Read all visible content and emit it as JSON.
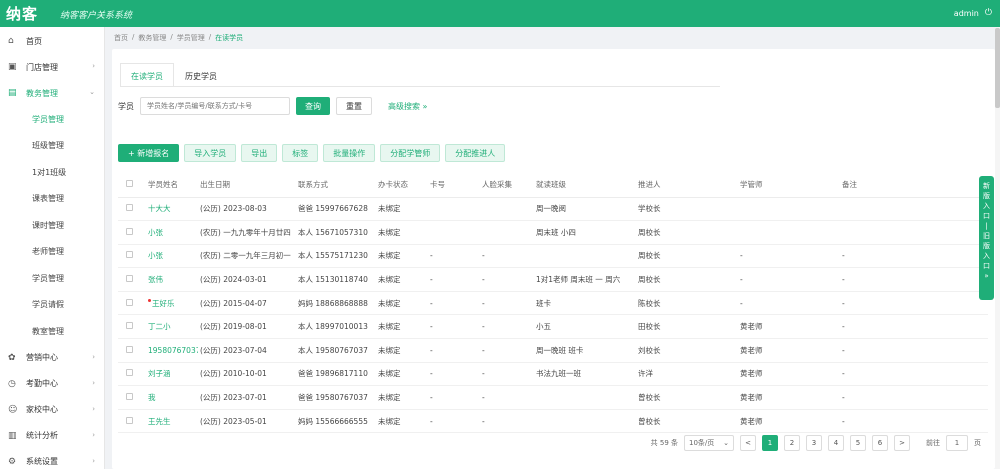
{
  "brand": {
    "logo": "纳客",
    "subtitle": "纳客客户关系系统"
  },
  "topbar": {
    "user": "admin"
  },
  "sidebar": {
    "items": [
      {
        "label": "首页",
        "icon": "home-icon"
      },
      {
        "label": "门店管理",
        "icon": "store-icon"
      },
      {
        "label": "教务管理",
        "icon": "book-icon",
        "active": true
      }
    ],
    "subitems": [
      {
        "label": "学员管理",
        "active": true
      },
      {
        "label": "班级管理"
      },
      {
        "label": "1对1班级"
      },
      {
        "label": "课表管理"
      },
      {
        "label": "课时管理"
      },
      {
        "label": "老师管理"
      },
      {
        "label": "学员管理"
      },
      {
        "label": "学员请假"
      },
      {
        "label": "教室管理"
      }
    ],
    "bottom_items": [
      {
        "label": "营销中心",
        "icon": "gift-icon"
      },
      {
        "label": "考勤中心",
        "icon": "clock-icon"
      },
      {
        "label": "家校中心",
        "icon": "people-icon"
      },
      {
        "label": "统计分析",
        "icon": "chart-icon"
      },
      {
        "label": "系统设置",
        "icon": "gear-icon"
      }
    ]
  },
  "breadcrumb": [
    "首页",
    "教务管理",
    "学员管理",
    "在读学员"
  ],
  "tabs": [
    "在读学员",
    "历史学员"
  ],
  "search": {
    "label": "学员",
    "placeholder": "学员姓名/学员编号/联系方式/卡号",
    "search_btn": "查询",
    "reset_btn": "重置",
    "advanced": "高级搜索 »"
  },
  "actions": {
    "primary": "+ 新增报名",
    "buttons": [
      "导入学员",
      "导出",
      "标签",
      "批量操作",
      "分配学管师",
      "分配推进人"
    ]
  },
  "table": {
    "headers": [
      "学员姓名",
      "出生日期",
      "联系方式",
      "办卡状态",
      "卡号",
      "人脸采集",
      "就读班级",
      "推进人",
      "学管师",
      "备注"
    ],
    "rows": [
      [
        "十大大",
        "(公历) 2023-08-03",
        "爸爸 15997667628",
        "未绑定",
        "",
        "",
        "周一晚阅",
        "学校长",
        "",
        ""
      ],
      [
        "小张",
        "(农历) 一九九零年十月廿四",
        "本人 15671057310",
        "未绑定",
        "",
        "",
        "周末班 小四",
        "周校长",
        "",
        ""
      ],
      [
        "小张",
        "(农历) 二零一九年三月初一",
        "本人 15575171230",
        "未绑定",
        "-",
        "-",
        "",
        "周校长",
        "-",
        "-"
      ],
      [
        "张伟",
        "(公历) 2024-03-01",
        "本人 15130118740",
        "未绑定",
        "-",
        "-",
        "1对1老师 周末班 一 周六",
        "周校长",
        "-",
        "-"
      ],
      [
        "王好乐",
        "(公历) 2015-04-07",
        "妈妈 18868868888",
        "未绑定",
        "-",
        "-",
        "班卡",
        "陈校长",
        "-",
        "-"
      ],
      [
        "丁二小",
        "(公历) 2019-08-01",
        "本人 18997010013",
        "未绑定",
        "-",
        "-",
        "小五",
        "田校长",
        "黄老师",
        "-"
      ],
      [
        "19580767037",
        "(公历) 2023-07-04",
        "本人 19580767037",
        "未绑定",
        "-",
        "-",
        "周一晚班 班卡",
        "刘校长",
        "黄老师",
        "-"
      ],
      [
        "刘子涵",
        "(公历) 2010-10-01",
        "爸爸 19896817110",
        "未绑定",
        "-",
        "-",
        "书法九班一班",
        "许洋",
        "黄老师",
        "-"
      ],
      [
        "我",
        "(公历) 2023-07-01",
        "爸爸 19580767037",
        "未绑定",
        "-",
        "-",
        "",
        "曾校长",
        "黄老师",
        "-"
      ],
      [
        "王先生",
        "(公历) 2023-05-01",
        "妈妈 15566666555",
        "未绑定",
        "-",
        "-",
        "",
        "曾校长",
        "黄老师",
        "-"
      ]
    ]
  },
  "pager": {
    "total": "共 59 条",
    "page_size": "10条/页",
    "pages": [
      "1",
      "2",
      "3",
      "4",
      "5",
      "6"
    ],
    "prev": "<",
    "next": ">",
    "goto_label": "前往",
    "goto_value": "1",
    "goto_suffix": "页"
  },
  "float_panel": [
    "新",
    "版",
    "入",
    "口",
    "|",
    "旧",
    "版",
    "入",
    "口",
    "»"
  ]
}
